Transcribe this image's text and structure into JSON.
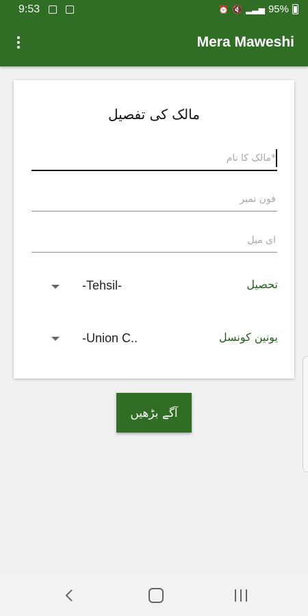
{
  "status_bar": {
    "time": "9:53",
    "battery": "95%",
    "left_icons": [
      "image-icon",
      "app-notification-icon"
    ],
    "right_icons": [
      "alarm-icon",
      "mute-icon",
      "signal-icon",
      "battery-icon"
    ]
  },
  "app_bar": {
    "title": "Mera Maweshi",
    "menu_icon": "more-vert-icon"
  },
  "form": {
    "title": "مالک کی تفصیل",
    "owner_name_placeholder": "*مالک کا نام",
    "phone_placeholder": "فون نمبر",
    "email_placeholder": "ای میل",
    "tehsil_label": "تحصیل",
    "tehsil_value": "-Tehsil-",
    "union_council_label": "یونین کونسل",
    "union_council_value": "-Union C.."
  },
  "next_button": {
    "label": "آگے بڑھیں"
  },
  "colors": {
    "primary": "#2f6e24",
    "label_green": "#1e5f19",
    "background": "#f1f1f1"
  }
}
